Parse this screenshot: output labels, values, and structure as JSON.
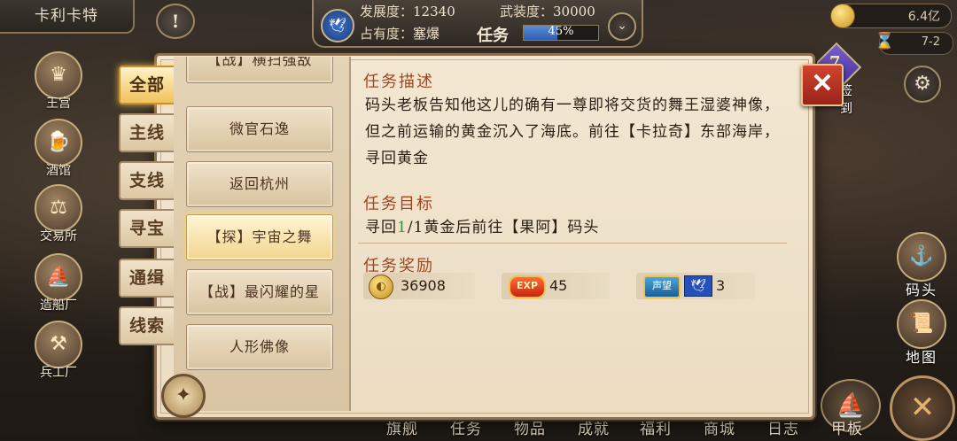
{
  "city": {
    "name": "卡利卡特"
  },
  "alert": {
    "icon": "exclamation-icon",
    "symbol": "!"
  },
  "stats": {
    "development_label": "发展度：",
    "development_value": "12340",
    "armament_label": "武装度：",
    "armament_value": "30000",
    "occupancy_label": "占有度：",
    "occupancy_value": "塞爆",
    "task_label": "任务",
    "task_progress_text": "45%",
    "task_progress_fraction": 0.45
  },
  "resources": {
    "money": "6.4亿",
    "date": "7-2"
  },
  "city_menu": [
    {
      "id": "palace",
      "label": "王宫",
      "icon": "crown-icon",
      "glyph": "♛"
    },
    {
      "id": "tavern",
      "label": "酒馆",
      "icon": "mug-icon",
      "glyph": "🍺"
    },
    {
      "id": "exchange",
      "label": "交易所",
      "icon": "scales-icon",
      "glyph": "⚖"
    },
    {
      "id": "shipyard",
      "label": "造船厂",
      "icon": "ship-icon",
      "glyph": "⛵"
    },
    {
      "id": "armory",
      "label": "兵工厂",
      "icon": "cannon-icon",
      "glyph": "⚒"
    }
  ],
  "right_menu": {
    "sign_in_label": "签到",
    "sign_in_number": "7",
    "dock_label": "码头",
    "map_label": "地图"
  },
  "bottom_nav": [
    "旗舰",
    "任务",
    "物品",
    "成就",
    "福利",
    "商城",
    "日志",
    "甲板"
  ],
  "quest_panel": {
    "categories": [
      "全部",
      "主线",
      "支线",
      "寻宝",
      "通缉",
      "线索"
    ],
    "active_category": 0,
    "quests": [
      "【战】横扫强敌",
      "微官石逸",
      "返回杭州",
      "【探】宇宙之舞",
      "【战】最闪耀的星",
      "人形佛像"
    ],
    "active_quest": 3,
    "description_title": "任务描述",
    "description": "码头老板告知他这儿的确有一尊即将交货的舞王湿婆神像，但之前运输的黄金沉入了海底。前往【卡拉奇】东部海岸，寻回黄金",
    "goal_title": "任务目标",
    "goal_prefix": "寻回",
    "goal_progress": "1",
    "goal_suffix": "/1黄金后前往【果阿】码头",
    "reward_title": "任务奖励",
    "rewards": {
      "gold": "36908",
      "exp_badge": "EXP",
      "exp": "45",
      "fame_badge": "声望",
      "fame": "3"
    }
  }
}
